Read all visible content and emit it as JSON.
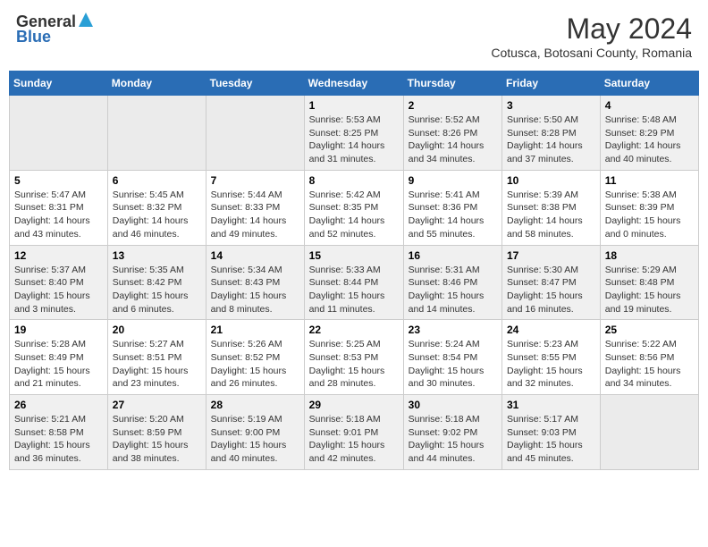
{
  "header": {
    "logo_general": "General",
    "logo_blue": "Blue",
    "month_year": "May 2024",
    "location": "Cotusca, Botosani County, Romania"
  },
  "weekdays": [
    "Sunday",
    "Monday",
    "Tuesday",
    "Wednesday",
    "Thursday",
    "Friday",
    "Saturday"
  ],
  "weeks": [
    [
      {
        "day": "",
        "sunrise": "",
        "sunset": "",
        "daylight": ""
      },
      {
        "day": "",
        "sunrise": "",
        "sunset": "",
        "daylight": ""
      },
      {
        "day": "",
        "sunrise": "",
        "sunset": "",
        "daylight": ""
      },
      {
        "day": "1",
        "sunrise": "Sunrise: 5:53 AM",
        "sunset": "Sunset: 8:25 PM",
        "daylight": "Daylight: 14 hours and 31 minutes."
      },
      {
        "day": "2",
        "sunrise": "Sunrise: 5:52 AM",
        "sunset": "Sunset: 8:26 PM",
        "daylight": "Daylight: 14 hours and 34 minutes."
      },
      {
        "day": "3",
        "sunrise": "Sunrise: 5:50 AM",
        "sunset": "Sunset: 8:28 PM",
        "daylight": "Daylight: 14 hours and 37 minutes."
      },
      {
        "day": "4",
        "sunrise": "Sunrise: 5:48 AM",
        "sunset": "Sunset: 8:29 PM",
        "daylight": "Daylight: 14 hours and 40 minutes."
      }
    ],
    [
      {
        "day": "5",
        "sunrise": "Sunrise: 5:47 AM",
        "sunset": "Sunset: 8:31 PM",
        "daylight": "Daylight: 14 hours and 43 minutes."
      },
      {
        "day": "6",
        "sunrise": "Sunrise: 5:45 AM",
        "sunset": "Sunset: 8:32 PM",
        "daylight": "Daylight: 14 hours and 46 minutes."
      },
      {
        "day": "7",
        "sunrise": "Sunrise: 5:44 AM",
        "sunset": "Sunset: 8:33 PM",
        "daylight": "Daylight: 14 hours and 49 minutes."
      },
      {
        "day": "8",
        "sunrise": "Sunrise: 5:42 AM",
        "sunset": "Sunset: 8:35 PM",
        "daylight": "Daylight: 14 hours and 52 minutes."
      },
      {
        "day": "9",
        "sunrise": "Sunrise: 5:41 AM",
        "sunset": "Sunset: 8:36 PM",
        "daylight": "Daylight: 14 hours and 55 minutes."
      },
      {
        "day": "10",
        "sunrise": "Sunrise: 5:39 AM",
        "sunset": "Sunset: 8:38 PM",
        "daylight": "Daylight: 14 hours and 58 minutes."
      },
      {
        "day": "11",
        "sunrise": "Sunrise: 5:38 AM",
        "sunset": "Sunset: 8:39 PM",
        "daylight": "Daylight: 15 hours and 0 minutes."
      }
    ],
    [
      {
        "day": "12",
        "sunrise": "Sunrise: 5:37 AM",
        "sunset": "Sunset: 8:40 PM",
        "daylight": "Daylight: 15 hours and 3 minutes."
      },
      {
        "day": "13",
        "sunrise": "Sunrise: 5:35 AM",
        "sunset": "Sunset: 8:42 PM",
        "daylight": "Daylight: 15 hours and 6 minutes."
      },
      {
        "day": "14",
        "sunrise": "Sunrise: 5:34 AM",
        "sunset": "Sunset: 8:43 PM",
        "daylight": "Daylight: 15 hours and 8 minutes."
      },
      {
        "day": "15",
        "sunrise": "Sunrise: 5:33 AM",
        "sunset": "Sunset: 8:44 PM",
        "daylight": "Daylight: 15 hours and 11 minutes."
      },
      {
        "day": "16",
        "sunrise": "Sunrise: 5:31 AM",
        "sunset": "Sunset: 8:46 PM",
        "daylight": "Daylight: 15 hours and 14 minutes."
      },
      {
        "day": "17",
        "sunrise": "Sunrise: 5:30 AM",
        "sunset": "Sunset: 8:47 PM",
        "daylight": "Daylight: 15 hours and 16 minutes."
      },
      {
        "day": "18",
        "sunrise": "Sunrise: 5:29 AM",
        "sunset": "Sunset: 8:48 PM",
        "daylight": "Daylight: 15 hours and 19 minutes."
      }
    ],
    [
      {
        "day": "19",
        "sunrise": "Sunrise: 5:28 AM",
        "sunset": "Sunset: 8:49 PM",
        "daylight": "Daylight: 15 hours and 21 minutes."
      },
      {
        "day": "20",
        "sunrise": "Sunrise: 5:27 AM",
        "sunset": "Sunset: 8:51 PM",
        "daylight": "Daylight: 15 hours and 23 minutes."
      },
      {
        "day": "21",
        "sunrise": "Sunrise: 5:26 AM",
        "sunset": "Sunset: 8:52 PM",
        "daylight": "Daylight: 15 hours and 26 minutes."
      },
      {
        "day": "22",
        "sunrise": "Sunrise: 5:25 AM",
        "sunset": "Sunset: 8:53 PM",
        "daylight": "Daylight: 15 hours and 28 minutes."
      },
      {
        "day": "23",
        "sunrise": "Sunrise: 5:24 AM",
        "sunset": "Sunset: 8:54 PM",
        "daylight": "Daylight: 15 hours and 30 minutes."
      },
      {
        "day": "24",
        "sunrise": "Sunrise: 5:23 AM",
        "sunset": "Sunset: 8:55 PM",
        "daylight": "Daylight: 15 hours and 32 minutes."
      },
      {
        "day": "25",
        "sunrise": "Sunrise: 5:22 AM",
        "sunset": "Sunset: 8:56 PM",
        "daylight": "Daylight: 15 hours and 34 minutes."
      }
    ],
    [
      {
        "day": "26",
        "sunrise": "Sunrise: 5:21 AM",
        "sunset": "Sunset: 8:58 PM",
        "daylight": "Daylight: 15 hours and 36 minutes."
      },
      {
        "day": "27",
        "sunrise": "Sunrise: 5:20 AM",
        "sunset": "Sunset: 8:59 PM",
        "daylight": "Daylight: 15 hours and 38 minutes."
      },
      {
        "day": "28",
        "sunrise": "Sunrise: 5:19 AM",
        "sunset": "Sunset: 9:00 PM",
        "daylight": "Daylight: 15 hours and 40 minutes."
      },
      {
        "day": "29",
        "sunrise": "Sunrise: 5:18 AM",
        "sunset": "Sunset: 9:01 PM",
        "daylight": "Daylight: 15 hours and 42 minutes."
      },
      {
        "day": "30",
        "sunrise": "Sunrise: 5:18 AM",
        "sunset": "Sunset: 9:02 PM",
        "daylight": "Daylight: 15 hours and 44 minutes."
      },
      {
        "day": "31",
        "sunrise": "Sunrise: 5:17 AM",
        "sunset": "Sunset: 9:03 PM",
        "daylight": "Daylight: 15 hours and 45 minutes."
      },
      {
        "day": "",
        "sunrise": "",
        "sunset": "",
        "daylight": ""
      }
    ]
  ]
}
